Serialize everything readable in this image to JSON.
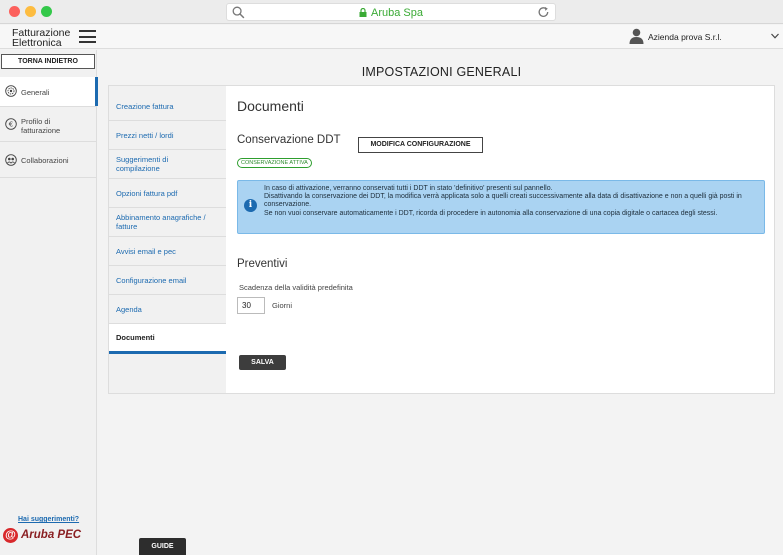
{
  "browser": {
    "url_text": "Aruba Spa",
    "accent_color": "#3aaa35"
  },
  "app": {
    "brand_line1": "Fatturazione",
    "brand_line2": "Elettronica",
    "company_name": "Azienda prova S.r.l."
  },
  "sidebar": {
    "back_label": "TORNA INDIETRO",
    "items": [
      {
        "label": "Generali",
        "icon": "gear-icon",
        "active": true
      },
      {
        "label": "Profilo di fatturazione",
        "icon": "euro-icon",
        "active": false
      },
      {
        "label": "Collaborazioni",
        "icon": "collaboration-icon",
        "active": false
      }
    ],
    "suggestion_link": "Hai suggerimenti?",
    "logo_text": "Aruba PEC"
  },
  "page": {
    "title": "IMPOSTAZIONI GENERALI"
  },
  "subnav": {
    "items": [
      {
        "label": "Creazione fattura"
      },
      {
        "label": "Prezzi netti / lordi"
      },
      {
        "label": "Suggerimenti di compilazione"
      },
      {
        "label": "Opzioni fattura pdf"
      },
      {
        "label": "Abbinamento anagrafiche / fatture"
      },
      {
        "label": "Avvisi email e pec"
      },
      {
        "label": "Configurazione email"
      },
      {
        "label": "Agenda"
      },
      {
        "label": "Documenti",
        "active": true
      }
    ]
  },
  "content": {
    "heading": "Documenti",
    "ddt_section_title": "Conservazione DDT",
    "modify_button": "MODIFICA CONFIGURAZIONE",
    "status_badge": "CONSERVAZIONE ATTIVA",
    "info_lines": [
      "In caso di attivazione, verranno conservati tutti i DDT in stato 'definitivo' presenti sul pannello.",
      "Disattivando la conservazione dei DDT, la modifica verrà applicata solo a quelli creati successivamente alla data di disattivazione e non a quelli già posti in conservazione.",
      "Se non vuoi conservare automaticamente i DDT, ricorda di procedere in autonomia alla conservazione di una copia digitale o cartacea degli stessi."
    ],
    "quotes_section_title": "Preventivi",
    "validity_label": "Scadenza della validità predefinita",
    "validity_value": "30",
    "validity_unit": "Giorni",
    "save_button": "SALVA"
  },
  "footer": {
    "guide_button": "GUIDE"
  },
  "colors": {
    "primary_blue": "#1c6ab0",
    "info_background": "#aad3f2",
    "active_green": "#2e9e2e",
    "dark_button": "#3d3d3d"
  }
}
